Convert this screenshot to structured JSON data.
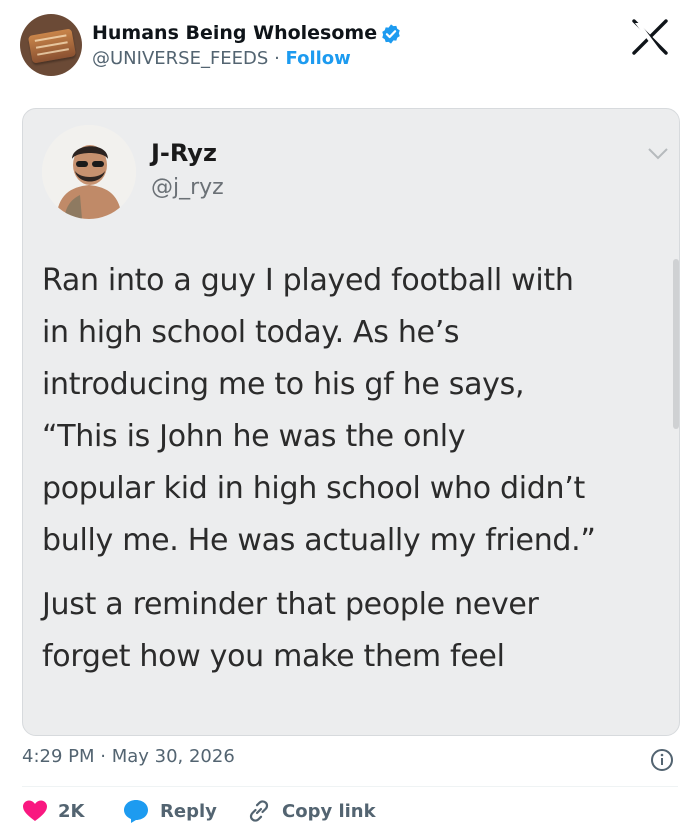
{
  "account": {
    "name": "Humans Being Wholesome",
    "handle": "@UNIVERSE_FEEDS",
    "separator": "·",
    "follow_label": "Follow"
  },
  "tweet": {
    "author_name": "J-Ryz",
    "author_handle": "@j_ryz",
    "lines": [
      "Ran into a guy I played football with",
      "in high school today. As he’s",
      "introducing me to his gf he says,",
      "“This is John he was the only",
      "popular kid in high school who didn’t",
      "bully me. He was actually my friend.”",
      "Just a reminder that people never",
      "forget how you make them feel"
    ]
  },
  "timestamp": "4:29 PM · May 30, 2026",
  "actions": {
    "like_count": "2K",
    "reply_label": "Reply",
    "copy_label": "Copy link"
  },
  "icons": {
    "brand_avatar": "wooden-plaque-avatar",
    "verified": "verified-badge-icon",
    "logo": "x-logo-icon",
    "chevron": "chevron-down-icon",
    "info": "info-icon",
    "like": "heart-icon",
    "reply": "speech-bubble-icon",
    "copy": "link-icon"
  },
  "colors": {
    "accent": "#1d9bf0",
    "heart": "#f91880",
    "muted": "#536471",
    "card_bg": "#ecedee"
  }
}
